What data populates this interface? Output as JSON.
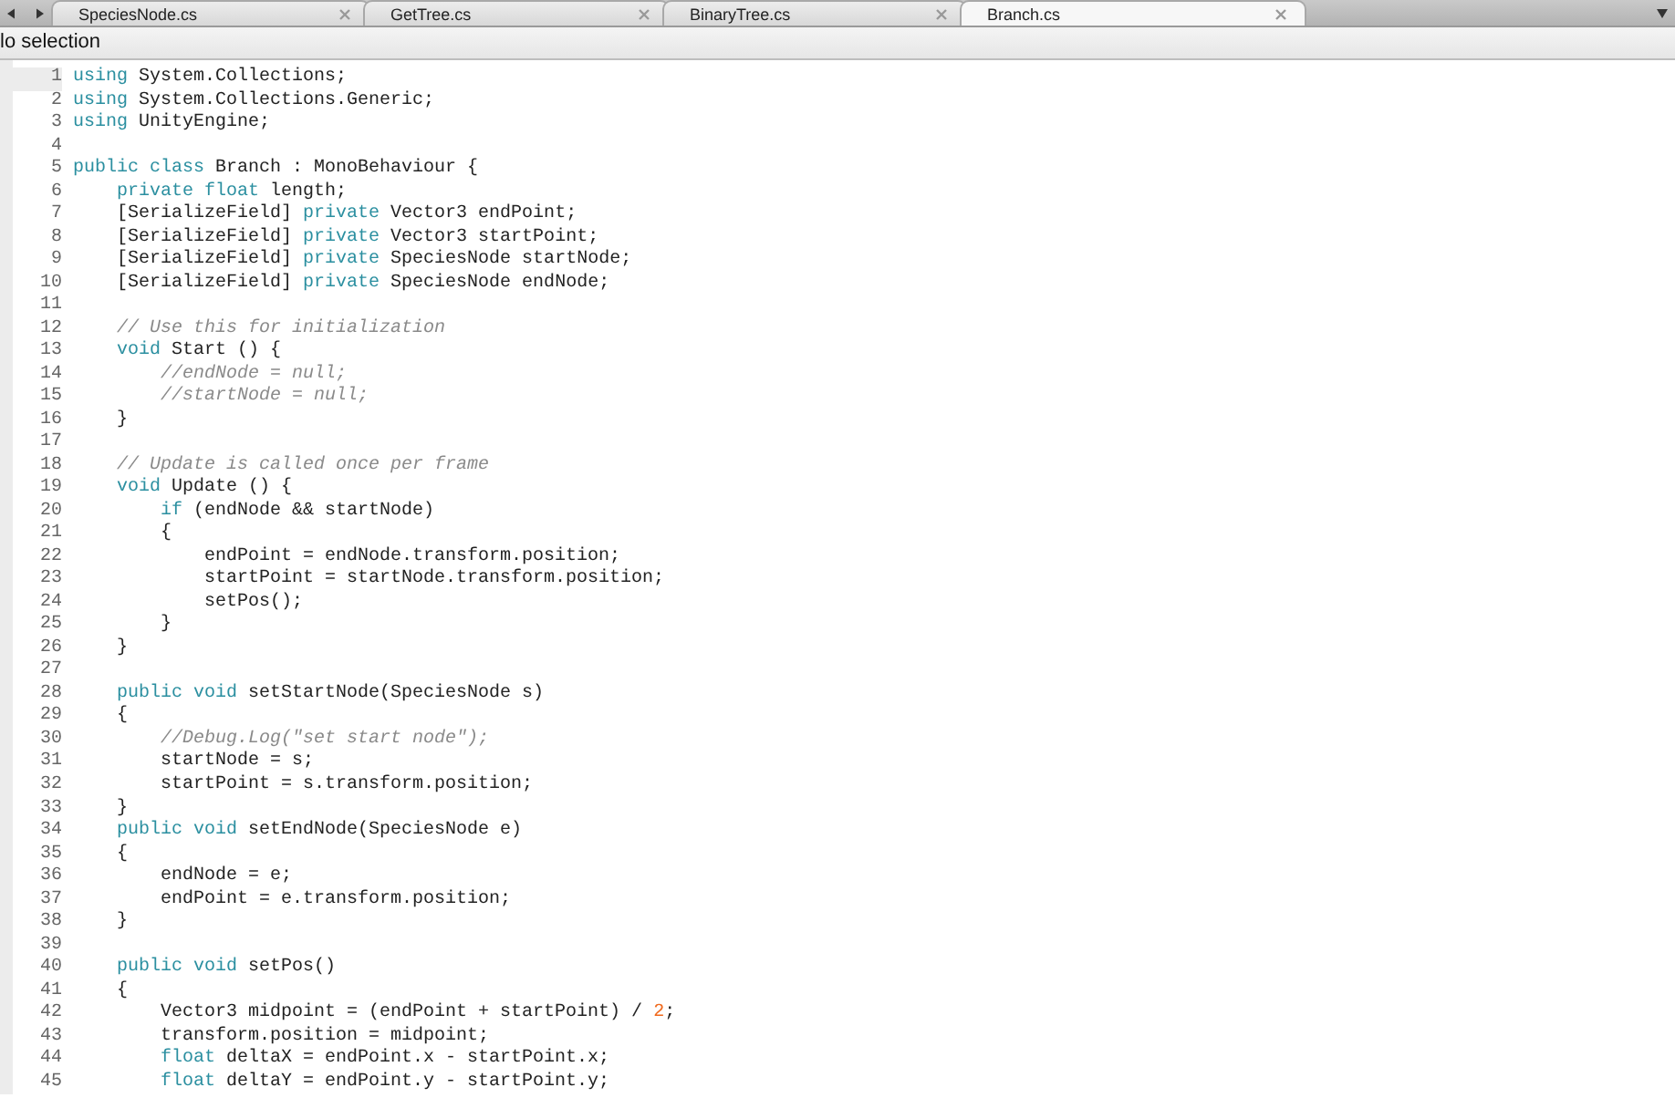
{
  "tabs": [
    {
      "label": "SpeciesNode.cs",
      "selected": false
    },
    {
      "label": "GetTree.cs",
      "selected": false
    },
    {
      "label": "BinaryTree.cs",
      "selected": false
    },
    {
      "label": "Branch.cs",
      "selected": true
    }
  ],
  "status": "lo selection",
  "code_lines": [
    {
      "number": "1",
      "tokens": [
        {
          "kind": "kw",
          "text": "using"
        },
        {
          "kind": "plain",
          "text": " System.Collections;"
        }
      ]
    },
    {
      "number": "2",
      "tokens": [
        {
          "kind": "kw",
          "text": "using"
        },
        {
          "kind": "plain",
          "text": " System.Collections.Generic;"
        }
      ]
    },
    {
      "number": "3",
      "tokens": [
        {
          "kind": "kw",
          "text": "using"
        },
        {
          "kind": "plain",
          "text": " UnityEngine;"
        }
      ]
    },
    {
      "number": "4"
    },
    {
      "number": "5",
      "tokens": [
        {
          "kind": "kw",
          "text": "public class"
        },
        {
          "kind": "plain",
          "text": " Branch : MonoBehaviour {"
        }
      ]
    },
    {
      "number": "6",
      "tokens": [
        {
          "kind": "kw",
          "text": "    private float"
        },
        {
          "kind": "plain",
          "text": " length;"
        }
      ]
    },
    {
      "number": "7",
      "tokens": [
        {
          "kind": "plain",
          "text": "    [SerializeField] "
        },
        {
          "kind": "kw",
          "text": "private"
        },
        {
          "kind": "plain",
          "text": " Vector3 endPoint;"
        }
      ]
    },
    {
      "number": "8",
      "tokens": [
        {
          "kind": "plain",
          "text": "    [SerializeField] "
        },
        {
          "kind": "kw",
          "text": "private"
        },
        {
          "kind": "plain",
          "text": " Vector3 startPoint;"
        }
      ]
    },
    {
      "number": "9",
      "tokens": [
        {
          "kind": "plain",
          "text": "    [SerializeField] "
        },
        {
          "kind": "kw",
          "text": "private"
        },
        {
          "kind": "plain",
          "text": " SpeciesNode startNode;"
        }
      ]
    },
    {
      "number": "10",
      "tokens": [
        {
          "kind": "plain",
          "text": "    [SerializeField] "
        },
        {
          "kind": "kw",
          "text": "private"
        },
        {
          "kind": "plain",
          "text": " SpeciesNode endNode;"
        }
      ]
    },
    {
      "number": "11"
    },
    {
      "number": "12",
      "tokens": [
        {
          "kind": "comment",
          "text": "    // Use this for initialization"
        }
      ]
    },
    {
      "number": "13",
      "tokens": [
        {
          "kind": "kw",
          "text": "    void"
        },
        {
          "kind": "plain",
          "text": " Start () {"
        }
      ]
    },
    {
      "number": "14",
      "tokens": [
        {
          "kind": "comment",
          "text": "        //endNode = null;"
        }
      ]
    },
    {
      "number": "15",
      "tokens": [
        {
          "kind": "comment",
          "text": "        //startNode = null;"
        }
      ]
    },
    {
      "number": "16",
      "tokens": [
        {
          "kind": "plain",
          "text": "    }"
        }
      ]
    },
    {
      "number": "17"
    },
    {
      "number": "18",
      "tokens": [
        {
          "kind": "comment",
          "text": "    // Update is called once per frame"
        }
      ]
    },
    {
      "number": "19",
      "tokens": [
        {
          "kind": "kw",
          "text": "    void"
        },
        {
          "kind": "plain",
          "text": " Update () {"
        }
      ]
    },
    {
      "number": "20",
      "tokens": [
        {
          "kind": "kw",
          "text": "        if"
        },
        {
          "kind": "plain",
          "text": " (endNode && startNode)"
        }
      ]
    },
    {
      "number": "21",
      "tokens": [
        {
          "kind": "plain",
          "text": "        {"
        }
      ]
    },
    {
      "number": "22",
      "tokens": [
        {
          "kind": "plain",
          "text": "            endPoint = endNode.transform.position;"
        }
      ]
    },
    {
      "number": "23",
      "tokens": [
        {
          "kind": "plain",
          "text": "            startPoint = startNode.transform.position;"
        }
      ]
    },
    {
      "number": "24",
      "tokens": [
        {
          "kind": "plain",
          "text": "            setPos();"
        }
      ]
    },
    {
      "number": "25",
      "tokens": [
        {
          "kind": "plain",
          "text": "        }"
        }
      ]
    },
    {
      "number": "26",
      "tokens": [
        {
          "kind": "plain",
          "text": "    }"
        }
      ]
    },
    {
      "number": "27"
    },
    {
      "number": "28",
      "tokens": [
        {
          "kind": "kw",
          "text": "    public void"
        },
        {
          "kind": "plain",
          "text": " setStartNode(SpeciesNode s)"
        }
      ]
    },
    {
      "number": "29",
      "tokens": [
        {
          "kind": "plain",
          "text": "    {"
        }
      ]
    },
    {
      "number": "30",
      "tokens": [
        {
          "kind": "comment",
          "text": "        //Debug.Log(\"set start node\");"
        }
      ]
    },
    {
      "number": "31",
      "tokens": [
        {
          "kind": "plain",
          "text": "        startNode = s;"
        }
      ]
    },
    {
      "number": "32",
      "tokens": [
        {
          "kind": "plain",
          "text": "        startPoint = s.transform.position;"
        }
      ]
    },
    {
      "number": "33",
      "tokens": [
        {
          "kind": "plain",
          "text": "    }"
        }
      ]
    },
    {
      "number": "34",
      "tokens": [
        {
          "kind": "kw",
          "text": "    public void"
        },
        {
          "kind": "plain",
          "text": " setEndNode(SpeciesNode e)"
        }
      ]
    },
    {
      "number": "35",
      "tokens": [
        {
          "kind": "plain",
          "text": "    {"
        }
      ]
    },
    {
      "number": "36",
      "tokens": [
        {
          "kind": "plain",
          "text": "        endNode = e;"
        }
      ]
    },
    {
      "number": "37",
      "tokens": [
        {
          "kind": "plain",
          "text": "        endPoint = e.transform.position;"
        }
      ]
    },
    {
      "number": "38",
      "tokens": [
        {
          "kind": "plain",
          "text": "    }"
        }
      ]
    },
    {
      "number": "39"
    },
    {
      "number": "40",
      "tokens": [
        {
          "kind": "kw",
          "text": "    public void"
        },
        {
          "kind": "plain",
          "text": " setPos()"
        }
      ]
    },
    {
      "number": "41",
      "tokens": [
        {
          "kind": "plain",
          "text": "    {"
        }
      ]
    },
    {
      "number": "42",
      "tokens": [
        {
          "kind": "plain",
          "text": "        Vector3 midpoint = (endPoint + startPoint) / "
        },
        {
          "kind": "num",
          "text": "2"
        },
        {
          "kind": "plain",
          "text": ";"
        }
      ]
    },
    {
      "number": "43",
      "tokens": [
        {
          "kind": "plain",
          "text": "        transform.position = midpoint;"
        }
      ]
    },
    {
      "number": "44",
      "tokens": [
        {
          "kind": "kw",
          "text": "        float"
        },
        {
          "kind": "plain",
          "text": " deltaX = endPoint.x - startPoint.x;"
        }
      ]
    },
    {
      "number": "45",
      "tokens": [
        {
          "kind": "kw",
          "text": "        float"
        },
        {
          "kind": "plain",
          "text": " deltaY = endPoint.y - startPoint.y;"
        }
      ]
    }
  ]
}
